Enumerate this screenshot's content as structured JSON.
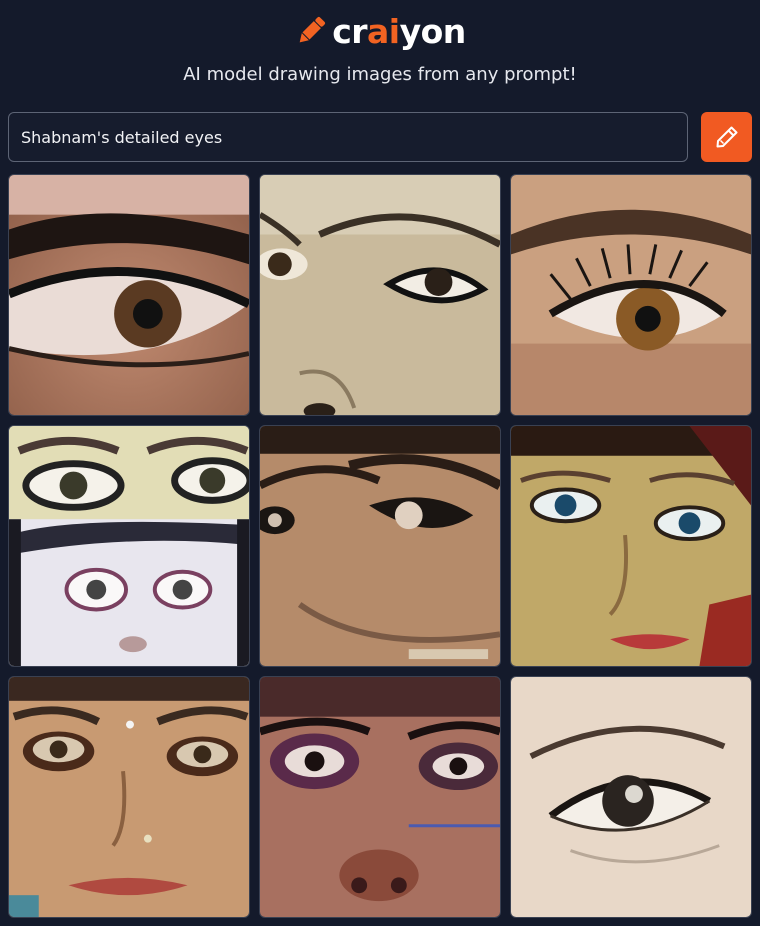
{
  "app": {
    "logo_parts": [
      "cr",
      "ai",
      "yon"
    ],
    "tagline": "AI model drawing images from any prompt!",
    "brand_color": "#f15a22"
  },
  "search": {
    "value": "Shabnam's detailed eyes",
    "button_icon": "pencil-icon"
  },
  "results": {
    "count": 9,
    "items": [
      {
        "icon": "single-eye-closeup-image"
      },
      {
        "icon": "face-eyes-nose-image"
      },
      {
        "icon": "eye-lashes-closeup-image"
      },
      {
        "icon": "stacked-eyes-collage-image"
      },
      {
        "icon": "face-dark-eyes-image"
      },
      {
        "icon": "face-blue-eyes-image"
      },
      {
        "icon": "face-bindi-nosepin-image"
      },
      {
        "icon": "face-purple-eyes-image"
      },
      {
        "icon": "sketched-eye-image"
      }
    ]
  }
}
